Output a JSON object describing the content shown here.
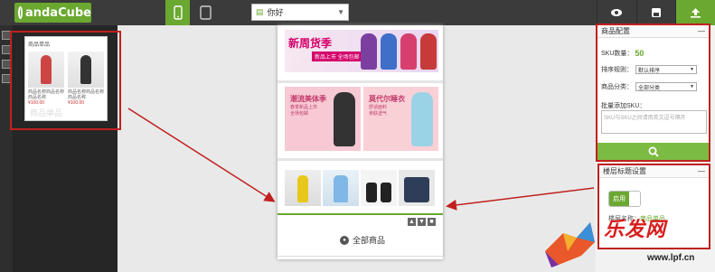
{
  "app": {
    "logo": "andaCube"
  },
  "toolbar": {
    "device_phone_icon": "phone-icon",
    "device_tablet_icon": "tablet-icon",
    "page_select_value": "你好",
    "right_buttons": [
      "preview-eye-icon",
      "save-icon",
      "publish-icon"
    ]
  },
  "sidepanel": {
    "card_title": "商品单品",
    "products": [
      {
        "name": "商品名称商品名称商品名称",
        "price": "¥100.00"
      },
      {
        "name": "商品名称商品名称商品名称",
        "price": "¥100.00"
      }
    ],
    "card_label": "商品单品"
  },
  "canvas": {
    "banner_title": "新周货季",
    "banner_sub": "新品上市 全场包邮",
    "promo1_title": "潮流美体季",
    "promo1_sub": "春季新品上市\n全场包邮",
    "promo2_title": "莫代尔睡衣",
    "promo2_sub": "舒适面料\n亲肤透气",
    "all_goods_label": "全部商品"
  },
  "config_panel": {
    "title": "商品配置",
    "sku_label": "SKU数量：",
    "sku_count": "50",
    "sort_label": "排序规则：",
    "sort_value": "默认排序",
    "category_label": "商品分类：",
    "category_value": "全部分类",
    "bulk_label": "批量添加SKU：",
    "bulk_placeholder": "SKU与SKU之间请用英文逗号隔开"
  },
  "floor_panel": {
    "title": "楼层标题设置",
    "toggle_label": "启用",
    "text_prefix": "楼层名称：",
    "text_value": "商品单品"
  },
  "watermark": {
    "brand": "乐发网",
    "url": "www.lpf.cn"
  },
  "colors": {
    "accent": "#6aa830",
    "highlight": "#c0201e",
    "topbar": "#3b3b3b"
  }
}
